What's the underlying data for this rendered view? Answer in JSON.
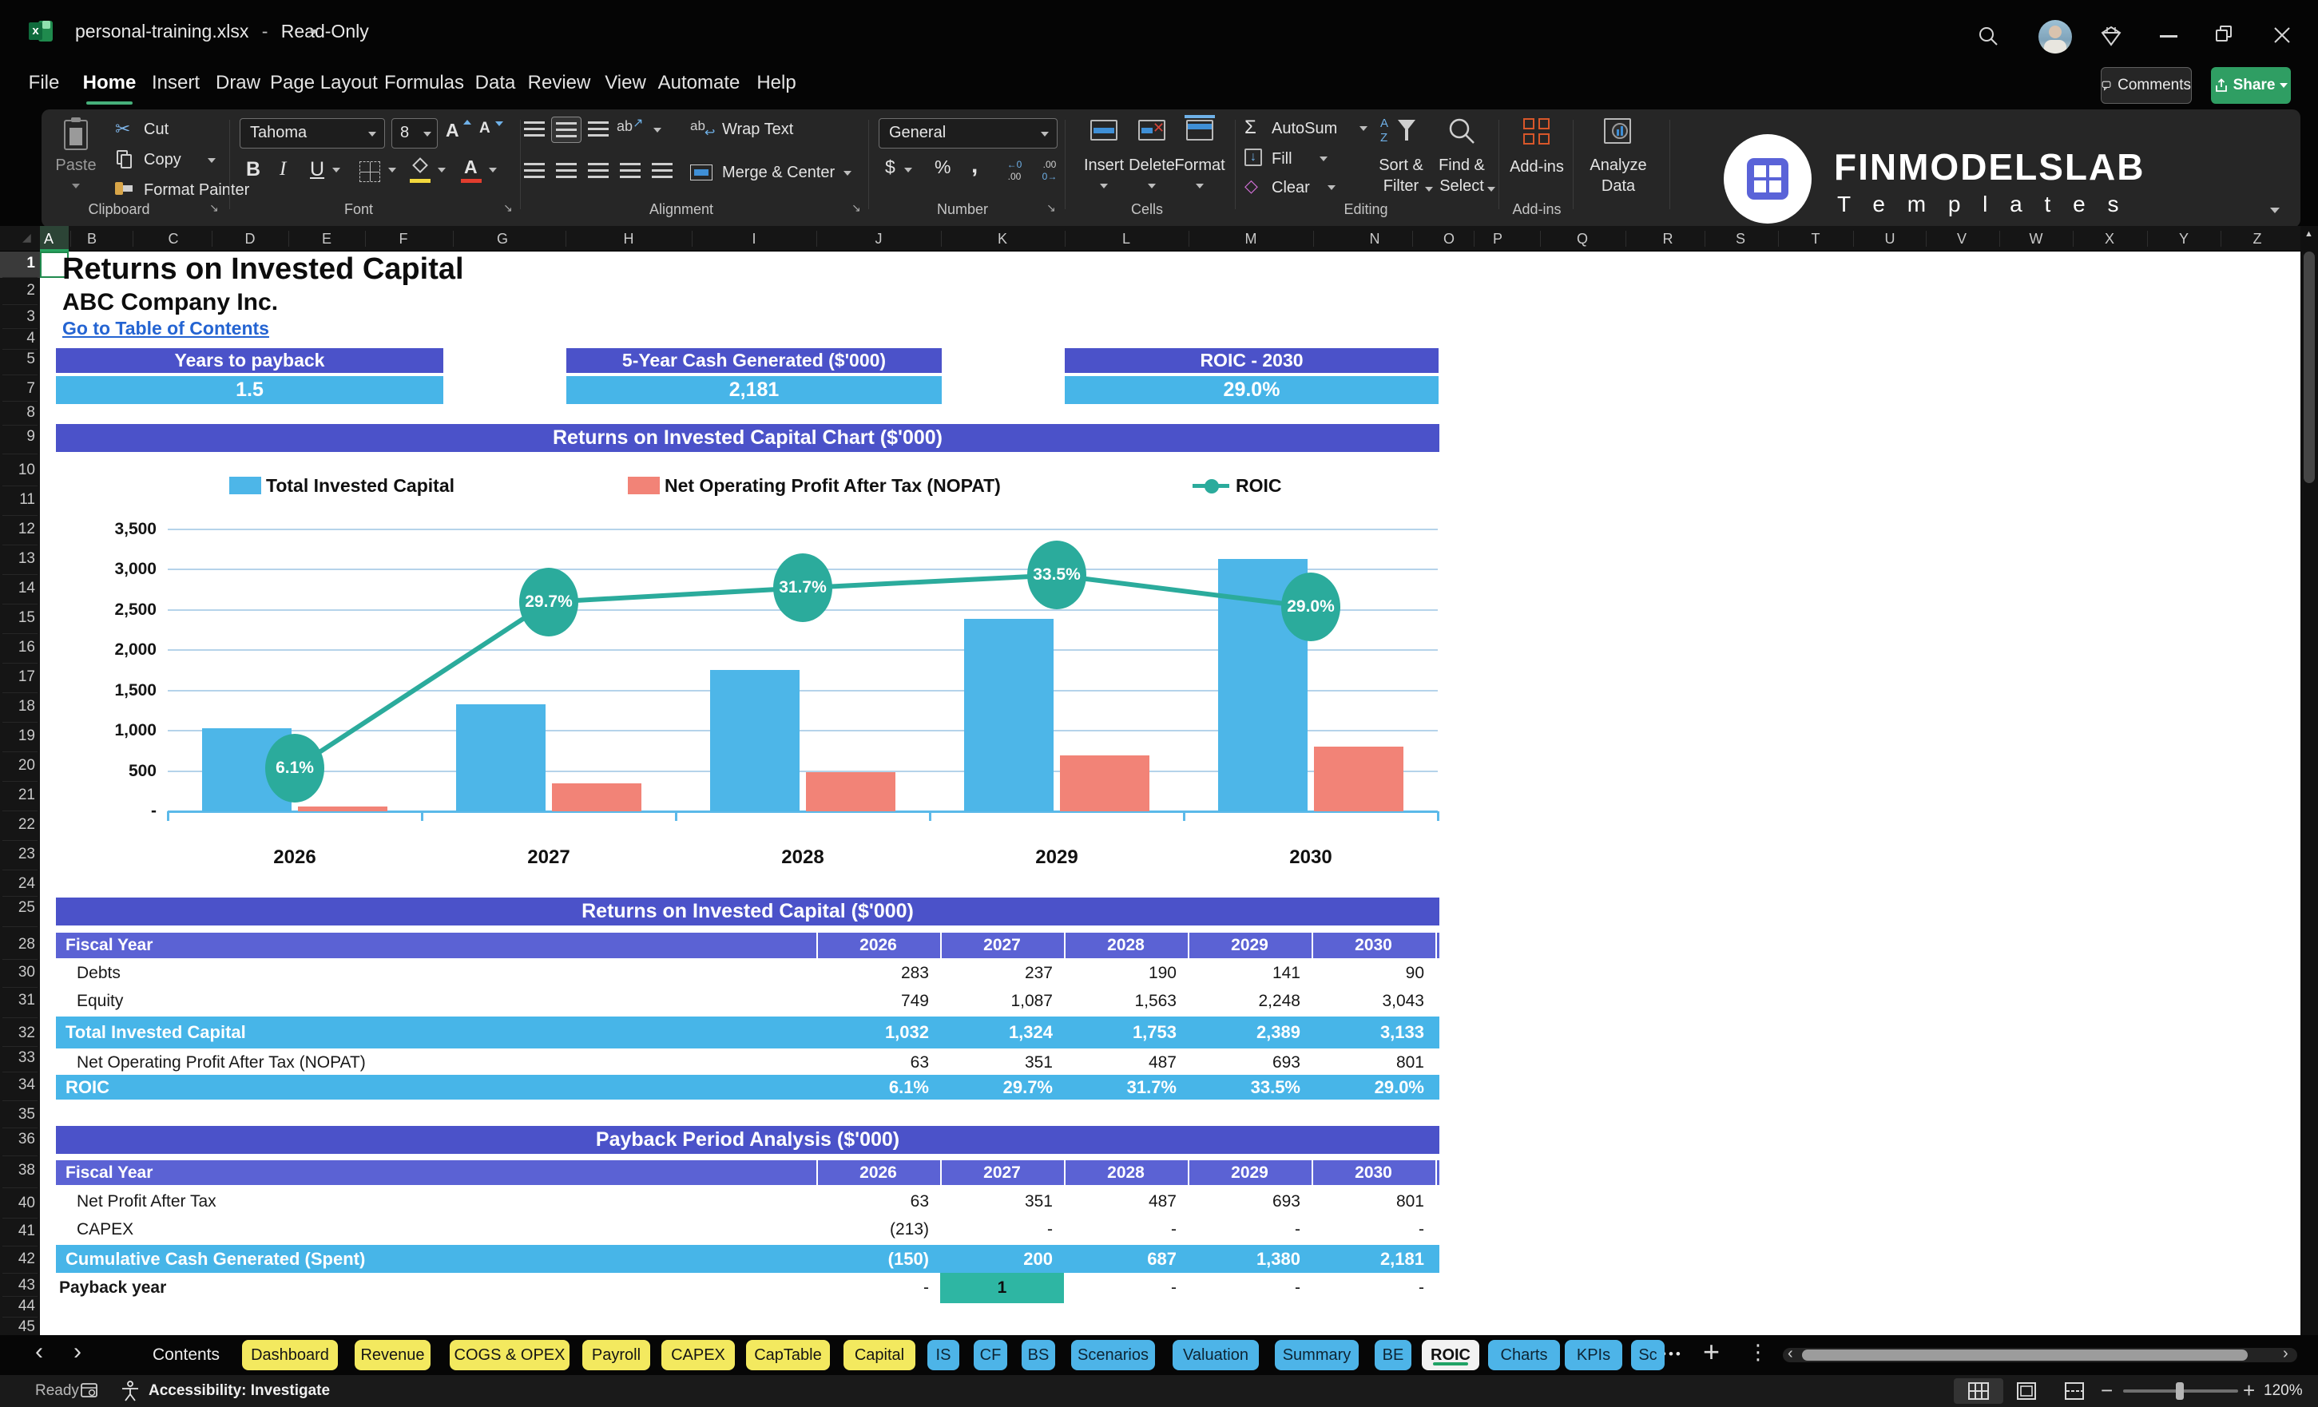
{
  "titlebar": {
    "filename": "personal-training.xlsx",
    "separator": "-",
    "mode": "Read-Only"
  },
  "menubar": {
    "items": [
      "File",
      "Home",
      "Insert",
      "Draw",
      "Page Layout",
      "Formulas",
      "Data",
      "Review",
      "View",
      "Automate",
      "Help"
    ],
    "active": "Home",
    "comments_label": "Comments",
    "share_label": "Share"
  },
  "ribbon": {
    "clipboard": {
      "label": "Clipboard",
      "paste": "Paste",
      "cut": "Cut",
      "copy": "Copy",
      "format_painter": "Format Painter"
    },
    "font": {
      "label": "Font",
      "family": "Tahoma",
      "size": "8"
    },
    "alignment": {
      "label": "Alignment",
      "wrap_text": "Wrap Text",
      "merge_center": "Merge & Center"
    },
    "number": {
      "label": "Number",
      "format": "General"
    },
    "cells": {
      "label": "Cells",
      "insert": "Insert",
      "delete": "Delete",
      "format": "Format"
    },
    "editing": {
      "label": "Editing",
      "autosum": "AutoSum",
      "fill": "Fill",
      "clear": "Clear",
      "sort_filter": "Sort & Filter",
      "find_select": "Find & Select"
    },
    "addins": {
      "label": "Add-ins",
      "button": "Add-ins"
    },
    "analyze": {
      "button": "Analyze Data"
    }
  },
  "icons": {
    "excel_x": "x",
    "cut": "✂",
    "autosum": "Σ",
    "clear": "◇",
    "fill_down": "↓",
    "bold": "B",
    "italic": "I",
    "underline": "U",
    "font_color_a": "A",
    "grow_a": "A",
    "shrink_a": "A",
    "currency": "$",
    "percent": "%",
    "comma": ",",
    "inc_decimal_top": "←0",
    "inc_decimal_bottom": ".00",
    "dec_decimal_top": ".00",
    "dec_decimal_bottom": "0→",
    "orientation": "ab",
    "wrap_ab": "ab",
    "sort_a": "A",
    "sort_z": "Z",
    "select_all": "◢",
    "scroll_up": "▲"
  },
  "brand": {
    "name": "FINMODELSLAB",
    "subtitle": "T e m p l a t e s"
  },
  "grid": {
    "columns": [
      "A",
      "B",
      "C",
      "D",
      "E",
      "F",
      "G",
      "H",
      "I",
      "J",
      "K",
      "L",
      "M",
      "N",
      "O",
      "P",
      "Q",
      "R",
      "S",
      "T",
      "U",
      "V",
      "W",
      "X",
      "Y",
      "Z"
    ],
    "rows": [
      "1",
      "2",
      "3",
      "4",
      "5",
      "7",
      "8",
      "9",
      "10",
      "11",
      "12",
      "13",
      "14",
      "15",
      "16",
      "17",
      "18",
      "19",
      "20",
      "21",
      "22",
      "23",
      "24",
      "25",
      "28",
      "30",
      "31",
      "32",
      "33",
      "34",
      "35",
      "36",
      "38",
      "40",
      "41",
      "42",
      "43",
      "44",
      "45"
    ]
  },
  "sheet": {
    "title": "Returns on Invested Capital",
    "company": "ABC Company Inc.",
    "link": "Go to Table of Contents",
    "kpis": [
      {
        "title": "Years to payback",
        "value": "1.5"
      },
      {
        "title": "5-Year Cash Generated ($'000)",
        "value": "2,181"
      },
      {
        "title": "ROIC - 2030",
        "value": "29.0%"
      }
    ]
  },
  "chart_data": {
    "type": "combo-bar-line",
    "title": "Returns on Invested Capital Chart ($'000)",
    "categories": [
      "2026",
      "2027",
      "2028",
      "2029",
      "2030"
    ],
    "series": [
      {
        "name": "Total Invested Capital",
        "type": "bar",
        "color": "#4db6e8",
        "values": [
          1032,
          1324,
          1753,
          2389,
          3133
        ]
      },
      {
        "name": "Net Operating Profit After Tax (NOPAT)",
        "type": "bar",
        "color": "#f28377",
        "values": [
          63,
          351,
          487,
          693,
          801
        ]
      },
      {
        "name": "ROIC",
        "type": "line",
        "color": "#2bab9c",
        "values": [
          6.1,
          29.7,
          31.7,
          33.5,
          29.0
        ],
        "labels": [
          "6.1%",
          "29.7%",
          "31.7%",
          "33.5%",
          "29.0%"
        ]
      }
    ],
    "y_ticks": [
      "3,500",
      "3,000",
      "2,500",
      "2,000",
      "1,500",
      "1,000",
      "500",
      "-"
    ],
    "ylim": [
      0,
      3500
    ],
    "secondary_ylim_pct": [
      0,
      40
    ],
    "grid": true,
    "legend_position": "top"
  },
  "tables": [
    {
      "title": "Returns on Invested Capital ($'000)",
      "header_label": "Fiscal Year",
      "years": [
        "2026",
        "2027",
        "2028",
        "2029",
        "2030"
      ],
      "rows": [
        {
          "label": "Debts",
          "values": [
            "283",
            "237",
            "190",
            "141",
            "90"
          ],
          "style": "plain"
        },
        {
          "label": "Equity",
          "values": [
            "749",
            "1,087",
            "1,563",
            "2,248",
            "3,043"
          ],
          "style": "plain"
        },
        {
          "label": "Total Invested Capital",
          "values": [
            "1,032",
            "1,324",
            "1,753",
            "2,389",
            "3,133"
          ],
          "style": "total"
        },
        {
          "label": "Net Operating Profit After Tax (NOPAT)",
          "values": [
            "63",
            "351",
            "487",
            "693",
            "801"
          ],
          "style": "plain"
        },
        {
          "label": "ROIC",
          "values": [
            "6.1%",
            "29.7%",
            "31.7%",
            "33.5%",
            "29.0%"
          ],
          "style": "total"
        }
      ]
    },
    {
      "title": "Payback Period Analysis ($'000)",
      "header_label": "Fiscal Year",
      "years": [
        "2026",
        "2027",
        "2028",
        "2029",
        "2030"
      ],
      "rows": [
        {
          "label": "Net Profit After Tax",
          "values": [
            "63",
            "351",
            "487",
            "693",
            "801"
          ],
          "style": "plain"
        },
        {
          "label": "CAPEX",
          "values": [
            "(213)",
            "-",
            "-",
            "-",
            "-"
          ],
          "style": "plain"
        },
        {
          "label": "Cumulative Cash Generated (Spent)",
          "values": [
            "(150)",
            "200",
            "687",
            "1,380",
            "2,181"
          ],
          "style": "total"
        },
        {
          "label": "Payback year",
          "values": [
            "-",
            "1",
            "-",
            "-",
            "-"
          ],
          "style": "payback",
          "highlight_index": 1
        }
      ]
    }
  ],
  "tabbar": {
    "nav_left": "‹",
    "nav_right": "›",
    "more": "•••",
    "add": "+",
    "menu": "⋮",
    "active": "ROIC",
    "tabs": [
      {
        "label": "Contents",
        "style": "plain"
      },
      {
        "label": "Dashboard",
        "style": "yellow"
      },
      {
        "label": "Revenue",
        "style": "yellow"
      },
      {
        "label": "COGS & OPEX",
        "style": "yellow"
      },
      {
        "label": "Payroll",
        "style": "yellow"
      },
      {
        "label": "CAPEX",
        "style": "yellow"
      },
      {
        "label": "CapTable",
        "style": "yellow"
      },
      {
        "label": "Capital",
        "style": "yellow"
      },
      {
        "label": "IS",
        "style": "blue"
      },
      {
        "label": "CF",
        "style": "blue"
      },
      {
        "label": "BS",
        "style": "blue"
      },
      {
        "label": "Scenarios",
        "style": "blue"
      },
      {
        "label": "Valuation",
        "style": "blue"
      },
      {
        "label": "Summary",
        "style": "blue"
      },
      {
        "label": "BE",
        "style": "blue"
      },
      {
        "label": "ROIC",
        "style": "active"
      },
      {
        "label": "Charts",
        "style": "blue"
      },
      {
        "label": "KPIs",
        "style": "blue"
      },
      {
        "label": "Sc",
        "style": "blue"
      }
    ]
  },
  "statusbar": {
    "ready": "Ready",
    "accessibility": "Accessibility: Investigate",
    "zoom": "120%"
  },
  "colors": {
    "accent_purple": "#4b52c9",
    "header_purple": "#5b62d4",
    "accent_cyan": "#47b5e8",
    "bar_blue": "#4db6e8",
    "bar_salmon": "#f28377",
    "line_teal": "#2bab9c",
    "payback_highlight": "#2eb6a3",
    "tab_yellow": "#f3e95f",
    "tab_blue": "#4db4e8",
    "active_tab_underline": "#21a366",
    "share_green": "#2f9e63",
    "link_blue": "#2464d2"
  }
}
